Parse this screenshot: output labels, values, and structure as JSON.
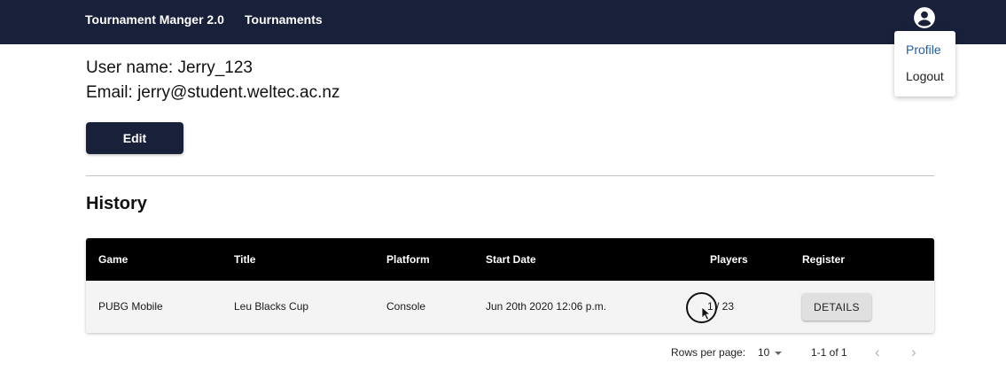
{
  "navbar": {
    "brand": "Tournament Manger 2.0",
    "tournaments_link": "Tournaments",
    "profile_icon": "account-circle-icon",
    "background": "#19203a"
  },
  "profile_menu": {
    "items": [
      "Profile",
      "Logout"
    ],
    "active_color": "#1e5fa8"
  },
  "user": {
    "name_line": "User name: Jerry_123",
    "email_line": "Email: jerry@student.weltec.ac.nz",
    "edit_label": "Edit"
  },
  "history": {
    "title": "History",
    "columns": [
      "Game",
      "Title",
      "Platform",
      "Start Date",
      "Players",
      "Register"
    ],
    "rows": [
      {
        "game": "PUBG Mobile",
        "title": "Leu Blacks Cup",
        "platform": "Console",
        "start_date": "Jun 20th 2020 12:06 p.m.",
        "players": "1 / 23",
        "register_label": "DETAILS"
      }
    ]
  },
  "pagination": {
    "rows_per_page_label": "Rows per page:",
    "rows_per_page_value": "10",
    "range": "1-1 of 1",
    "prev_icon": "chevron-left-icon",
    "next_icon": "chevron-right-icon"
  }
}
